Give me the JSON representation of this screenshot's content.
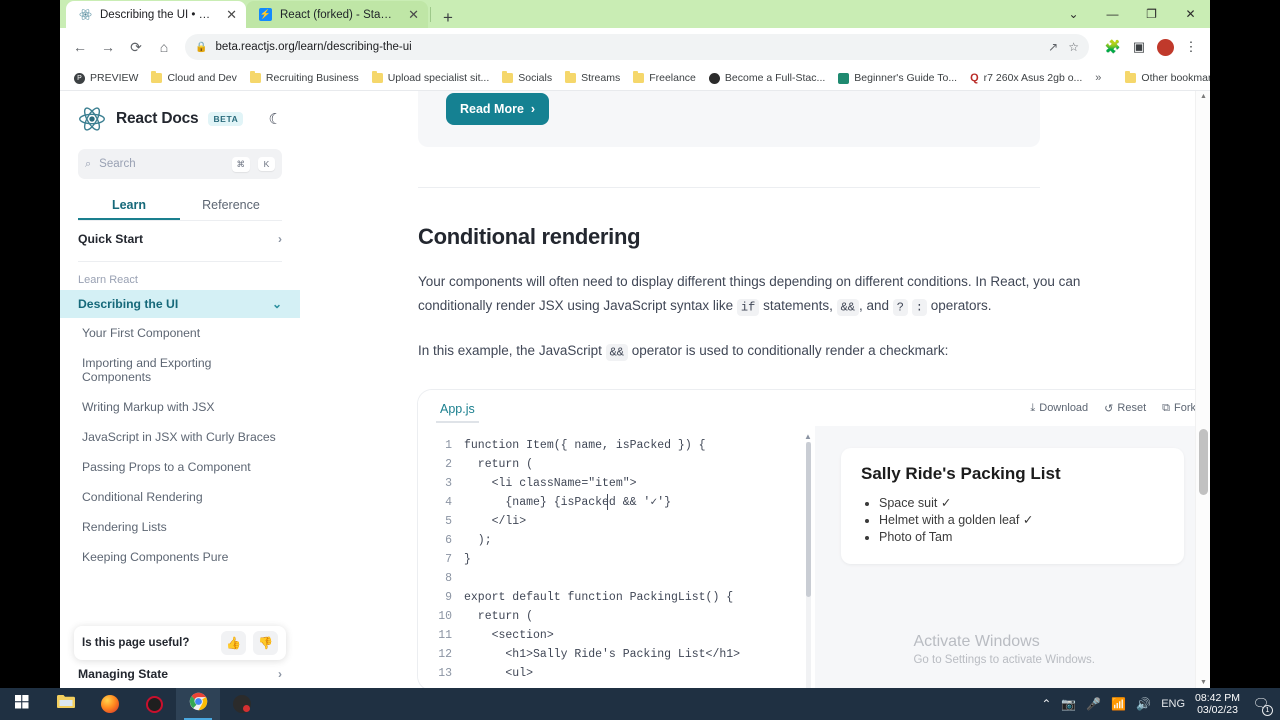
{
  "browser": {
    "tabs": [
      {
        "title": "Describing the UI • React",
        "favicon": "react-icon",
        "active": true
      },
      {
        "title": "React (forked) - StackBlitz",
        "favicon": "stackblitz-icon",
        "active": false
      }
    ],
    "new_tab_label": "+",
    "close_label": "✕",
    "window_controls": {
      "minimize_group": "⌄",
      "minimize": "—",
      "maximize": "❐",
      "close": "✕"
    },
    "nav": {
      "back": "←",
      "forward": "→",
      "reload": "⟳",
      "home": "⌂"
    },
    "omnibox": {
      "lock_icon": "lock-icon",
      "url": "beta.reactjs.org/learn/describing-the-ui",
      "share_icon": "↗",
      "star_icon": "☆"
    },
    "toolbar_icons": [
      "extensions-icon",
      "sidepanel-icon",
      "profile-avatar",
      "menu-icon"
    ],
    "bookmarks": [
      {
        "label": "PREVIEW",
        "icon": "preview-icon"
      },
      {
        "label": "Cloud and Dev",
        "icon": "folder-icon"
      },
      {
        "label": "Recruiting Business",
        "icon": "folder-icon"
      },
      {
        "label": "Upload specialist sit...",
        "icon": "folder-icon"
      },
      {
        "label": "Socials",
        "icon": "folder-icon"
      },
      {
        "label": "Streams",
        "icon": "folder-icon"
      },
      {
        "label": "Freelance",
        "icon": "folder-icon"
      },
      {
        "label": "Become a Full-Stac...",
        "icon": "site-icon"
      },
      {
        "label": "Beginner's Guide To...",
        "icon": "site-icon"
      },
      {
        "label": "r7 260x Asus 2gb o...",
        "icon": "quora-icon"
      }
    ],
    "bookmarks_overflow": "»",
    "other_bookmarks": "Other bookmarks"
  },
  "sidebar": {
    "brand": "React Docs",
    "badge": "BETA",
    "theme_toggle_icon": "moon-icon",
    "search": {
      "placeholder": "Search",
      "icon": "search-icon",
      "kbd1": "⌘",
      "kbd2": "K"
    },
    "tabs": [
      {
        "label": "Learn",
        "selected": true
      },
      {
        "label": "Reference",
        "selected": false
      }
    ],
    "quick_start": {
      "label": "Quick Start",
      "chevron": "›"
    },
    "section_label": "Learn React",
    "active_item": {
      "label": "Describing the UI",
      "chevron": "⌄"
    },
    "items": [
      {
        "label": "Your First Component"
      },
      {
        "label": "Importing and Exporting Components"
      },
      {
        "label": "Writing Markup with JSX"
      },
      {
        "label": "JavaScript in JSX with Curly Braces"
      },
      {
        "label": "Passing Props to a Component"
      },
      {
        "label": "Conditional Rendering"
      },
      {
        "label": "Rendering Lists"
      },
      {
        "label": "Keeping Components Pure"
      }
    ],
    "bottom_item": {
      "label": "Managing State",
      "chevron": "›"
    },
    "feedback": {
      "question": "Is this page useful?",
      "up_icon": "thumbs-up-icon",
      "down_icon": "thumbs-down-icon"
    }
  },
  "main": {
    "read_more": {
      "label": "Read More",
      "arrow": "›"
    },
    "section_title": "Conditional rendering",
    "paragraph1_a": "Your components will often need to display different things depending on different conditions. In React, you can conditionally render JSX using JavaScript syntax like ",
    "paragraph1_code1": "if",
    "paragraph1_b": " statements, ",
    "paragraph1_code2": "&&",
    "paragraph1_c": ", and ",
    "paragraph1_code3": "?",
    "paragraph1_code4": ":",
    "paragraph1_d": " operators.",
    "paragraph2_a": "In this example, the JavaScript ",
    "paragraph2_code": "&&",
    "paragraph2_b": " operator is used to conditionally render a checkmark:"
  },
  "sandpack": {
    "file_tab": "App.js",
    "actions": [
      {
        "label": "Download",
        "icon": "download-icon"
      },
      {
        "label": "Reset",
        "icon": "reset-icon"
      },
      {
        "label": "Fork",
        "icon": "fork-icon"
      }
    ],
    "code_lines": [
      {
        "n": "1",
        "text": "function Item({ name, isPacked }) {"
      },
      {
        "n": "2",
        "text": "  return ("
      },
      {
        "n": "3",
        "text": "    <li className=\"item\">"
      },
      {
        "n": "4",
        "text": "      {name} {isPacked && '✓'}"
      },
      {
        "n": "5",
        "text": "    </li>"
      },
      {
        "n": "6",
        "text": "  );"
      },
      {
        "n": "7",
        "text": "}"
      },
      {
        "n": "8",
        "text": ""
      },
      {
        "n": "9",
        "text": "export default function PackingList() {"
      },
      {
        "n": "10",
        "text": "  return ("
      },
      {
        "n": "11",
        "text": "    <section>"
      },
      {
        "n": "12",
        "text": "      <h1>Sally Ride's Packing List</h1>"
      },
      {
        "n": "13",
        "text": "      <ul>"
      }
    ],
    "preview": {
      "heading": "Sally Ride's Packing List",
      "items": [
        "Space suit ✓",
        "Helmet with a golden leaf ✓",
        "Photo of Tam"
      ]
    }
  },
  "watermark": {
    "title": "Activate Windows",
    "subtitle": "Go to Settings to activate Windows."
  },
  "taskbar": {
    "apps": [
      {
        "name": "start-button",
        "icon": "windows-icon"
      },
      {
        "name": "file-explorer",
        "icon": "folder-icon"
      },
      {
        "name": "firefox",
        "icon": "firefox-icon"
      },
      {
        "name": "opera-gx",
        "icon": "opera-icon"
      },
      {
        "name": "chrome",
        "icon": "chrome-icon",
        "active": true
      },
      {
        "name": "discord",
        "icon": "discord-icon"
      }
    ],
    "tray": {
      "chevron": "⌃",
      "icons": [
        "camera-icon",
        "microphone-icon",
        "wifi-icon",
        "volume-icon"
      ],
      "language": "ENG",
      "time": "08:42 PM",
      "date": "03/02/23",
      "notification_count": "1"
    }
  },
  "colors": {
    "accent": "#158192",
    "sidebar_active_bg": "#d4f0f5",
    "tabstrip": "#c9edb4",
    "taskbar": "#1f3042"
  }
}
